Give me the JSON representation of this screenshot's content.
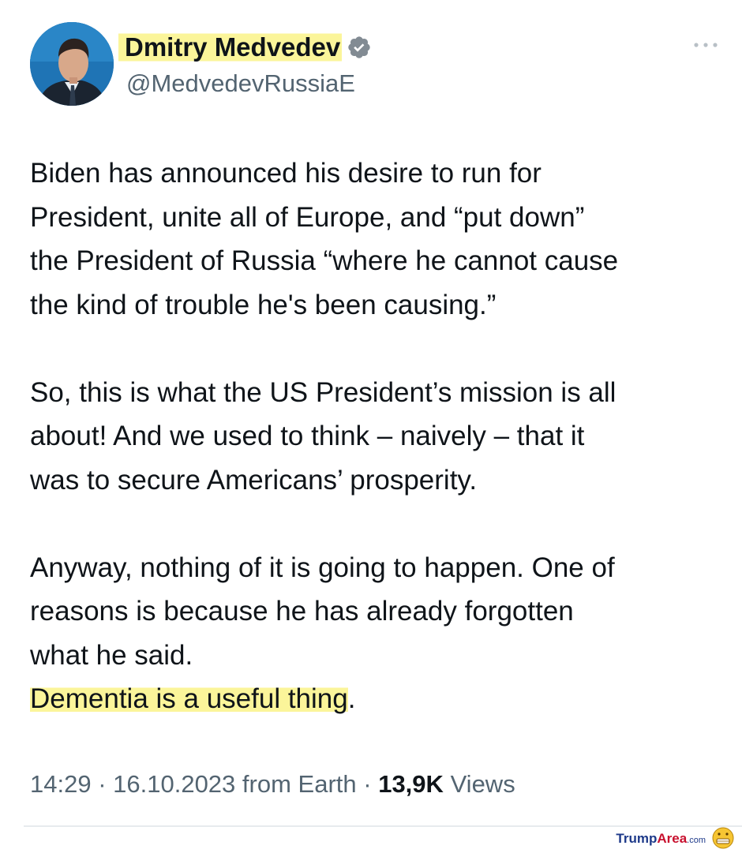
{
  "author": {
    "display_name": "Dmitry Medvedev",
    "handle": "@MedvedevRussiaE",
    "verified_badge_icon": "verified-badge-icon"
  },
  "tweet": {
    "paragraphs": [
      "Biden has announced his desire to run for\nPresident, unite all of Europe, and “put down”\nthe President of Russia “where he cannot cause\nthe kind of trouble he's been causing.”",
      "So, this is what the US President’s mission is all\nabout! And we used to think – naively – that it\nwas to secure Americans’ prosperity.",
      "Anyway, nothing of it is going to happen. One of\nreasons is because he has already forgotten\nwhat he said."
    ],
    "highlighted_line": "Dementia is a useful thing",
    "highlighted_line_tail": "."
  },
  "meta": {
    "time": "14:29",
    "separator": " · ",
    "date": "16.10.2023",
    "source": "from Earth",
    "views_count": "13,9K",
    "views_label": "Views"
  },
  "watermark": {
    "text": "TrumpArea.com"
  },
  "colors": {
    "highlight": "#fbf59a",
    "secondary_text": "#536471",
    "primary_text": "#0f1419"
  }
}
